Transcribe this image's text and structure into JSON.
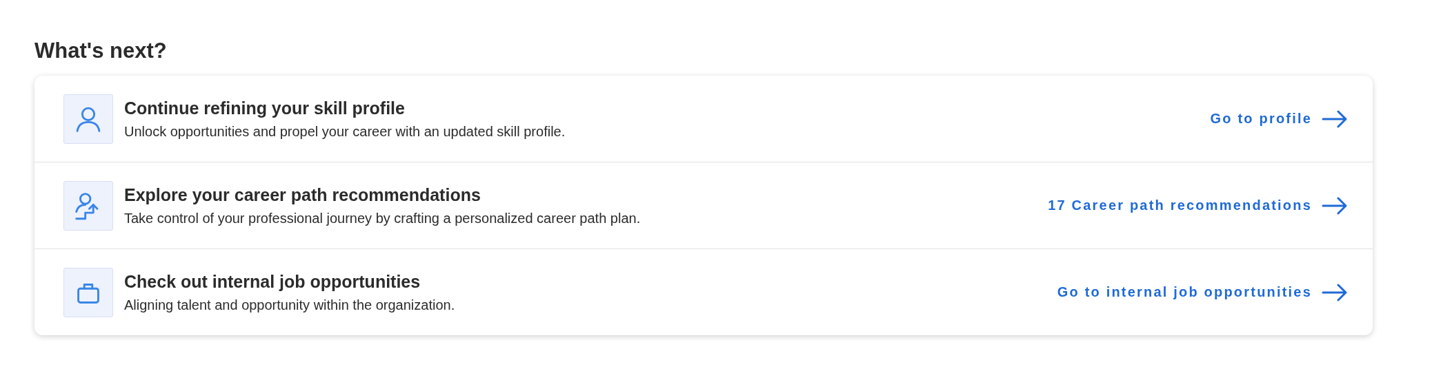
{
  "heading": "What's next?",
  "items": [
    {
      "kind": "profile",
      "title": "Continue refining your skill profile",
      "description": "Unlock opportunities and propel your career with an updated skill profile.",
      "link": "Go to profile"
    },
    {
      "kind": "career",
      "title": "Explore your career path recommendations",
      "description": "Take control of your professional journey by crafting a personalized career path plan.",
      "link": "17 Career path recommendations"
    },
    {
      "kind": "jobs",
      "title": "Check out internal job opportunities",
      "description": "Aligning talent and opportunity within the organization.",
      "link": "Go to internal job opportunities"
    }
  ]
}
